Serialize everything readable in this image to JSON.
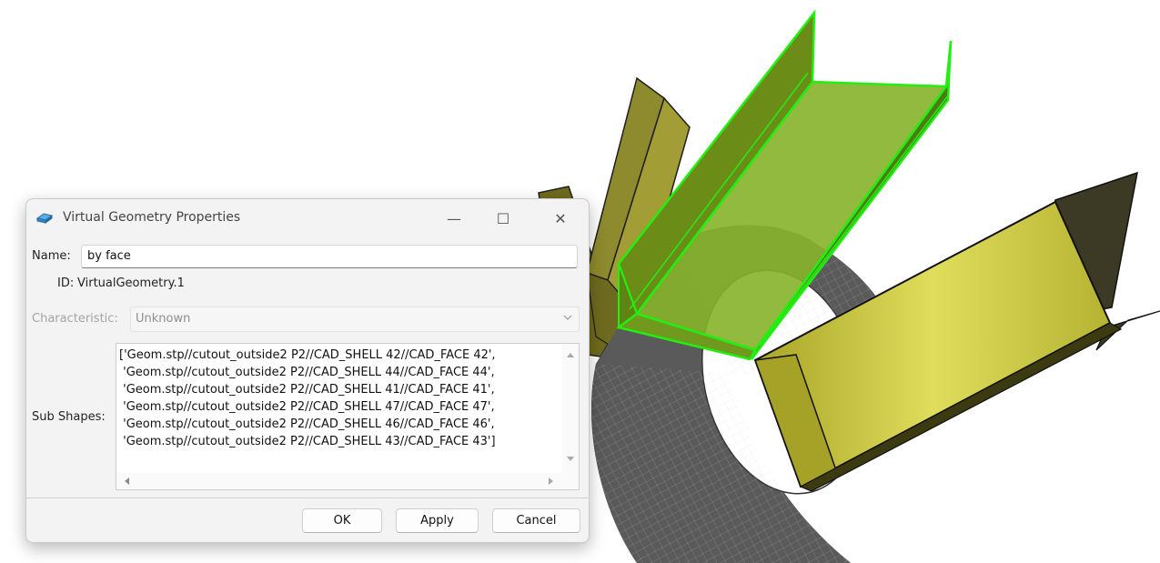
{
  "dialog": {
    "title": "Virtual Geometry Properties",
    "window_controls": {
      "minimize": "—",
      "maximize": "☐",
      "close": "✕"
    },
    "name_label": "Name:",
    "name_value": "by face",
    "id_label": "ID:",
    "id_value": "VirtualGeometry.1",
    "characteristic_label": "Characteristic:",
    "characteristic_value": "Unknown",
    "sub_shapes_label": "Sub Shapes:",
    "sub_shapes_lines": [
      "['Geom.stp//cutout_outside2 P2//CAD_SHELL 42//CAD_FACE 42',",
      " 'Geom.stp//cutout_outside2 P2//CAD_SHELL 44//CAD_FACE 44',",
      " 'Geom.stp//cutout_outside2 P2//CAD_SHELL 41//CAD_FACE 41',",
      " 'Geom.stp//cutout_outside2 P2//CAD_SHELL 47//CAD_FACE 47',",
      " 'Geom.stp//cutout_outside2 P2//CAD_SHELL 46//CAD_FACE 46',",
      " 'Geom.stp//cutout_outside2 P2//CAD_SHELL 43//CAD_FACE 43']"
    ],
    "buttons": {
      "ok": "OK",
      "apply": "Apply",
      "cancel": "Cancel"
    }
  },
  "icons": {
    "app": "virtual-geometry-icon",
    "dropdown": "chevron-down-icon"
  },
  "colors": {
    "selection_highlight": "#22ee11",
    "shape_fill": "#b8b22e",
    "cylinder_mesh": "#5e5e5e"
  }
}
